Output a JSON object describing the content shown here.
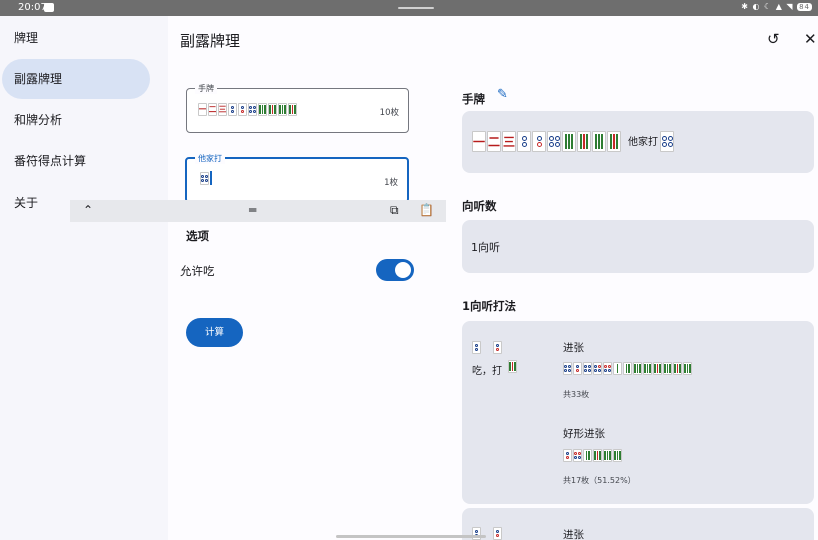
{
  "status_bar": {
    "time": "20:07",
    "battery": "84"
  },
  "nav": {
    "items": [
      {
        "label": "牌理",
        "active": false
      },
      {
        "label": "副露牌理",
        "active": true
      },
      {
        "label": "和牌分析",
        "active": false
      },
      {
        "label": "番符得点计算",
        "active": false
      },
      {
        "label": "关于",
        "active": false
      }
    ]
  },
  "page": {
    "title": "副露牌理"
  },
  "hand_field": {
    "label": "手牌",
    "count": "10枚"
  },
  "discard_field": {
    "label": "他家打",
    "count": "1枚"
  },
  "toolbar": {
    "up": "⌃",
    "menu": "═",
    "copy": "⧉",
    "paste": "📋"
  },
  "options": {
    "title": "选项",
    "allow_chi_label": "允许吃",
    "allow_chi": true
  },
  "calc_button": "计算",
  "result": {
    "hand_title": "手牌",
    "discard_text": "他家打",
    "shanten_title": "向听数",
    "shanten_value": "1向听",
    "strategy_title": "1向听打法",
    "action_text": "吃，打",
    "ukeire_title": "进张",
    "ukeire_total": "共33枚",
    "good_title": "好形进张",
    "good_total": "共17枚（51.52%）",
    "next_ukeire_title": "进张"
  }
}
